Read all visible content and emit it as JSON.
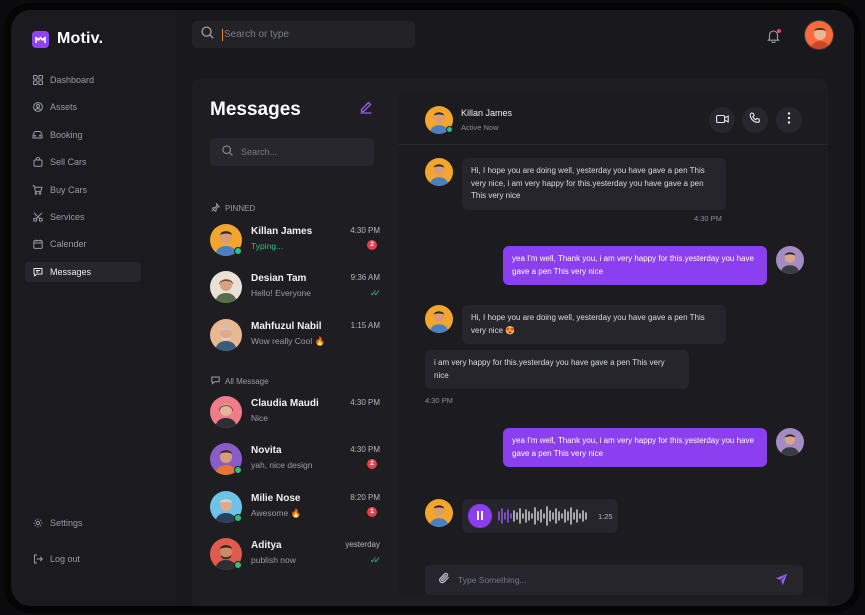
{
  "app": {
    "name": "Motiv.",
    "accent": "#8b3ff0"
  },
  "nav": {
    "items": [
      {
        "label": "Dashboard",
        "icon": "dashboard-icon"
      },
      {
        "label": "Assets",
        "icon": "user-circle-icon"
      },
      {
        "label": "Booking",
        "icon": "car-icon"
      },
      {
        "label": "Sell Cars",
        "icon": "bag-icon"
      },
      {
        "label": "Buy Cars",
        "icon": "cart-icon"
      },
      {
        "label": "Services",
        "icon": "scissors-icon"
      },
      {
        "label": "Calender",
        "icon": "calendar-icon"
      },
      {
        "label": "Messages",
        "icon": "chat-icon",
        "active": true
      }
    ],
    "settings": "Settings",
    "logout": "Log out"
  },
  "header": {
    "search_placeholder": "Search or type"
  },
  "messages": {
    "title": "Messages",
    "search_placeholder": "Search...",
    "pinned_label": "PINNED",
    "all_label": "All Message",
    "pinned": [
      {
        "name": "Killan James",
        "preview": "Typing...",
        "time": "4:30 PM",
        "badge": "2",
        "typing": true,
        "online": true
      },
      {
        "name": "Desian Tam",
        "preview": "Hello! Everyone",
        "time": "9:36 AM",
        "read": true
      },
      {
        "name": "Mahfuzul Nabil",
        "preview": "Wow really Cool 🔥",
        "time": "1:15 AM"
      }
    ],
    "all": [
      {
        "name": "Claudia Maudi",
        "preview": "Nice",
        "time": "4:30 PM"
      },
      {
        "name": "Novita",
        "preview": "yah, nice design",
        "time": "4:30 PM",
        "badge": "2",
        "online": true
      },
      {
        "name": "Milie Nose",
        "preview": "Awesome 🔥",
        "time": "8:20 PM",
        "badge": "1",
        "online": true
      },
      {
        "name": "Aditya",
        "preview": "publish now",
        "time": "yesterday",
        "read": true,
        "online": true
      }
    ]
  },
  "chat": {
    "contact_name": "Killan James",
    "contact_status": "Active Now",
    "messages": [
      {
        "text": "Hi, I hope you are doing well, yesterday you have gave a pen This very nice, i am very happy for this.yesterday you have gave a pen This very nice"
      },
      {
        "time": "4:30 PM"
      },
      {
        "text": "yea I'm well, Thank you, i am very happy for this.yesterday you have gave a pen This very nice"
      },
      {
        "text": "Hi, I hope you are doing well, yesterday you have gave a pen This very nice 😍"
      },
      {
        "text": "i am very happy for this.yesterday you have gave a pen This very nice"
      },
      {
        "time": "4:30 PM"
      },
      {
        "text": "yea I'm well, Thank you, i am very happy for this.yesterday you have gave a pen This very nice"
      }
    ],
    "voice_duration": "1:25",
    "composer_placeholder": "Type Something..."
  }
}
